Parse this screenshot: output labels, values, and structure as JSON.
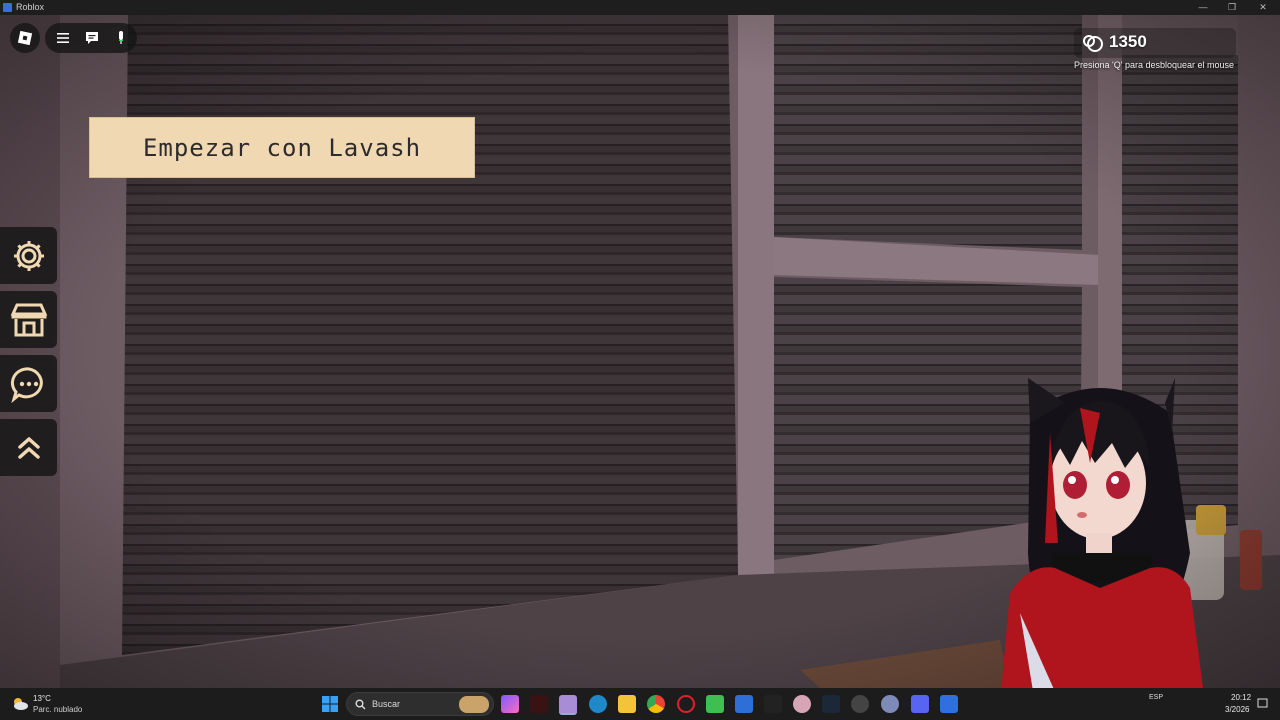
{
  "window": {
    "title": "Roblox",
    "minimize": "—",
    "maximize": "❐",
    "close": "✕"
  },
  "hud": {
    "start_banner": "Empezar con Lavash",
    "currency": "1350",
    "unlock_hint": "Presiona 'Q' para desbloquear el mouse"
  },
  "side_menu": [
    "gear-icon",
    "shop-icon",
    "chat-icon",
    "chevrons-up-icon"
  ],
  "taskbar": {
    "weather_temp": "13°C",
    "weather_desc": "Parc. nublado",
    "search_label": "Buscar",
    "language": "ESP",
    "time": "20:12",
    "date": "3/2026"
  },
  "colors": {
    "banner_bg": "#f0d9b2",
    "shutter": "#3a3336",
    "wall": "#6b5a60",
    "avatar_shirt": "#b0141c"
  }
}
